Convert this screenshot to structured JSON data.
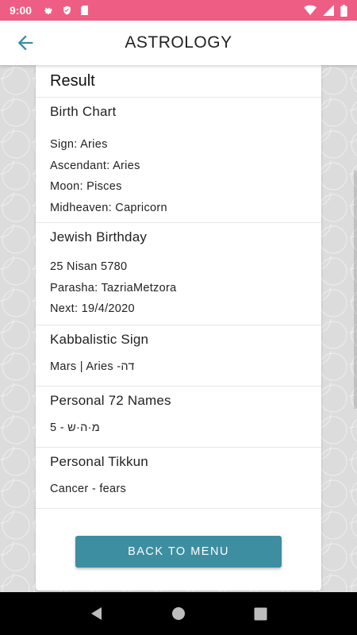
{
  "status_bar": {
    "time": "9:00"
  },
  "app_bar": {
    "title": "ASTROLOGY"
  },
  "card": {
    "title": "Result",
    "birth_chart": {
      "title": "Birth Chart",
      "lines": [
        "Sign: Aries",
        "Ascendant: Aries",
        "Moon: Pisces",
        "Midheaven: Capricorn"
      ]
    },
    "jewish_birthday": {
      "title": "Jewish Birthday",
      "lines": [
        "25 Nisan 5780",
        "Parasha: TazriaMetzora",
        "Next: 19/4/2020"
      ]
    },
    "kabbalistic_sign": {
      "title": "Kabbalistic Sign",
      "value": "Mars | Aries -דה"
    },
    "personal_72_names": {
      "title": "Personal 72 Names",
      "value": "מ·ה·ש - 5"
    },
    "personal_tikkun": {
      "title": "Personal Tikkun",
      "value": "Cancer - fears"
    },
    "back_button_label": "BACK TO MENU"
  },
  "colors": {
    "status_bar": "#ee5d83",
    "accent": "#3d8ea0",
    "background": "#dcdcdc"
  },
  "icons": {
    "status_left": [
      "settings-icon",
      "shield-icon",
      "sd-card-icon"
    ],
    "status_right": [
      "wifi-icon",
      "signal-icon",
      "battery-icon"
    ],
    "back": "arrow-back-icon",
    "nav": [
      "back-triangle-icon",
      "home-circle-icon",
      "recents-square-icon"
    ]
  }
}
